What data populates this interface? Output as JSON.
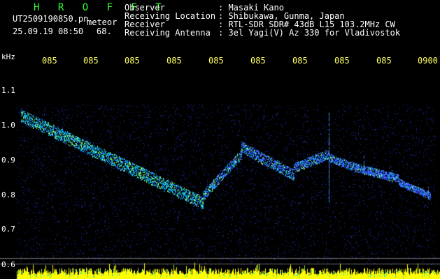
{
  "header": {
    "brand": "H R O F F T",
    "filename": "UT2509190850.pn",
    "tag": "meteor",
    "datetime": "25.09.19 08:50",
    "count": "68."
  },
  "metadata": [
    {
      "key": "Observer",
      "value": ": Masaki Kano"
    },
    {
      "key": "Receiving Location",
      "value": ": Shibukawa, Gunma, Japan"
    },
    {
      "key": "Receiver",
      "value": ": RTL-SDR SDR# 43dB L15 103.2MHz CW"
    },
    {
      "key": "Receiving Antenna",
      "value": ": 3el Yagi(V) Az 330 for Vladivostok"
    }
  ],
  "axis": {
    "unit": "kHz",
    "time_ticks": [
      "085",
      "085",
      "085",
      "085",
      "085",
      "085",
      "085",
      "085",
      "085",
      "0900"
    ],
    "freq_ticks": [
      "1.1",
      "1.0",
      "0.9",
      "0.8",
      "0.7",
      "0.6"
    ],
    "freq_values": [
      1.1,
      1.0,
      0.9,
      0.8,
      0.7,
      0.6
    ]
  },
  "colors": {
    "background": "#000000",
    "noise": "#1a2a9a",
    "signal_mid": "#00b4ff",
    "signal_hot": "#a0ff50",
    "brand": "#33ff33",
    "tick": "#ffff66",
    "histogram": "#ffff00"
  }
}
